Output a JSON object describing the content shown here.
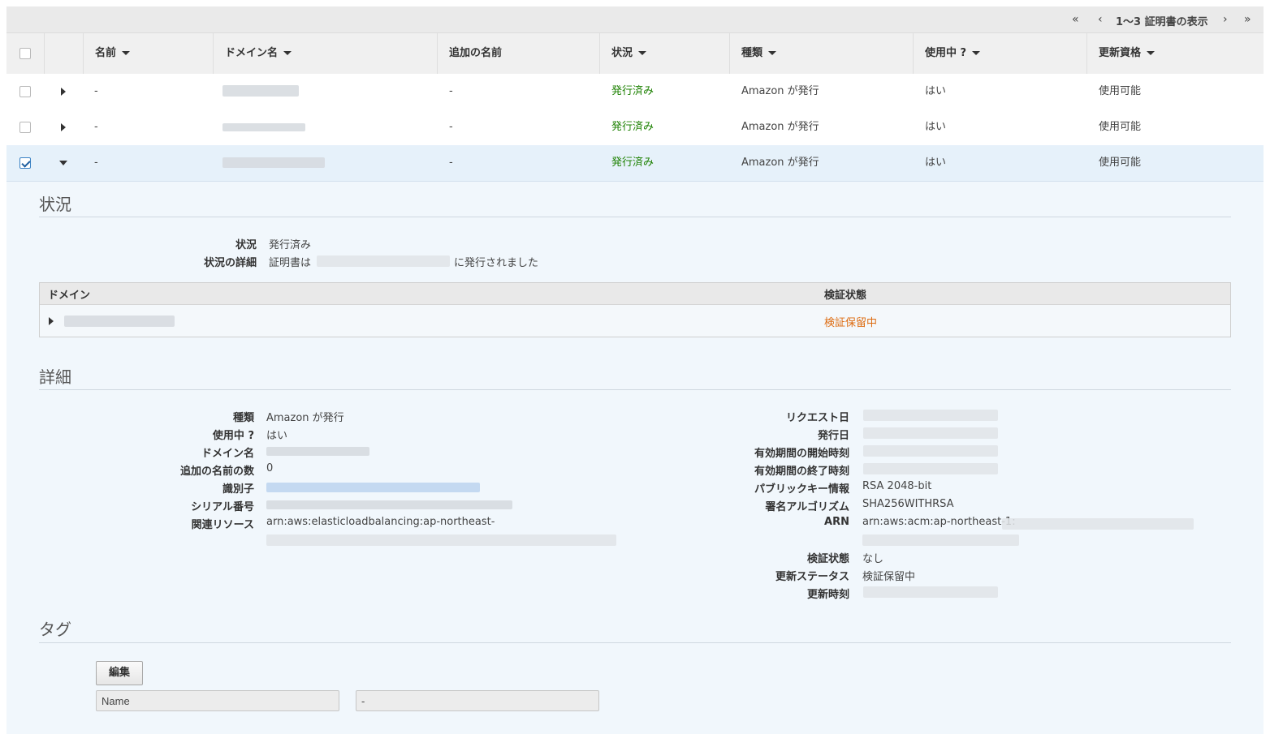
{
  "pagination": {
    "first": "«",
    "prev": "‹",
    "text": "1〜3 証明書の表示",
    "next": "›",
    "last": "»"
  },
  "columns": [
    "名前",
    "ドメイン名",
    "追加の名前",
    "状況",
    "種類",
    "使用中 ?",
    "更新資格"
  ],
  "rows": [
    {
      "name": "-",
      "additional": "-",
      "status": "発行済み",
      "type": "Amazon が発行",
      "in_use": "はい",
      "renewal": "使用可能",
      "checked": false,
      "expanded": false
    },
    {
      "name": "-",
      "additional": "-",
      "status": "発行済み",
      "type": "Amazon が発行",
      "in_use": "はい",
      "renewal": "使用可能",
      "checked": false,
      "expanded": false
    },
    {
      "name": "-",
      "additional": "-",
      "status": "発行済み",
      "type": "Amazon が発行",
      "in_use": "はい",
      "renewal": "使用可能",
      "checked": true,
      "expanded": true
    }
  ],
  "status_section": {
    "title": "状況",
    "status_label": "状況",
    "status_value": "発行済み",
    "detail_label": "状況の詳細",
    "detail_prefix": "証明書は",
    "detail_suffix": "に発行されました",
    "table_domain_header": "ドメイン",
    "table_validation_header": "検証状態",
    "table_validation_value": "検証保留中"
  },
  "details_section": {
    "title": "詳細",
    "left": {
      "type_label": "種類",
      "type_value": "Amazon が発行",
      "in_use_label": "使用中 ?",
      "in_use_value": "はい",
      "domain_label": "ドメイン名",
      "additional_count_label": "追加の名前の数",
      "additional_count_value": "0",
      "identifier_label": "識別子",
      "serial_label": "シリアル番号",
      "resources_label": "関連リソース",
      "resources_value": "arn:aws:elasticloadbalancing:ap-northeast-"
    },
    "right": {
      "requested_label": "リクエスト日",
      "issued_label": "発行日",
      "not_before_label": "有効期間の開始時刻",
      "not_after_label": "有効期間の終了時刻",
      "public_key_label": "パブリックキー情報",
      "public_key_value": "RSA 2048-bit",
      "sig_alg_label": "署名アルゴリズム",
      "sig_alg_value": "SHA256WITHRSA",
      "arn_label": "ARN",
      "arn_value": "arn:aws:acm:ap-northeast-1:",
      "validation_label": "検証状態",
      "validation_value": "なし",
      "renewal_status_label": "更新ステータス",
      "renewal_status_value": "検証保留中",
      "updated_label": "更新時刻"
    }
  },
  "tags_section": {
    "title": "タグ",
    "edit_label": "編集",
    "key_value": "Name",
    "value_value": "-"
  }
}
